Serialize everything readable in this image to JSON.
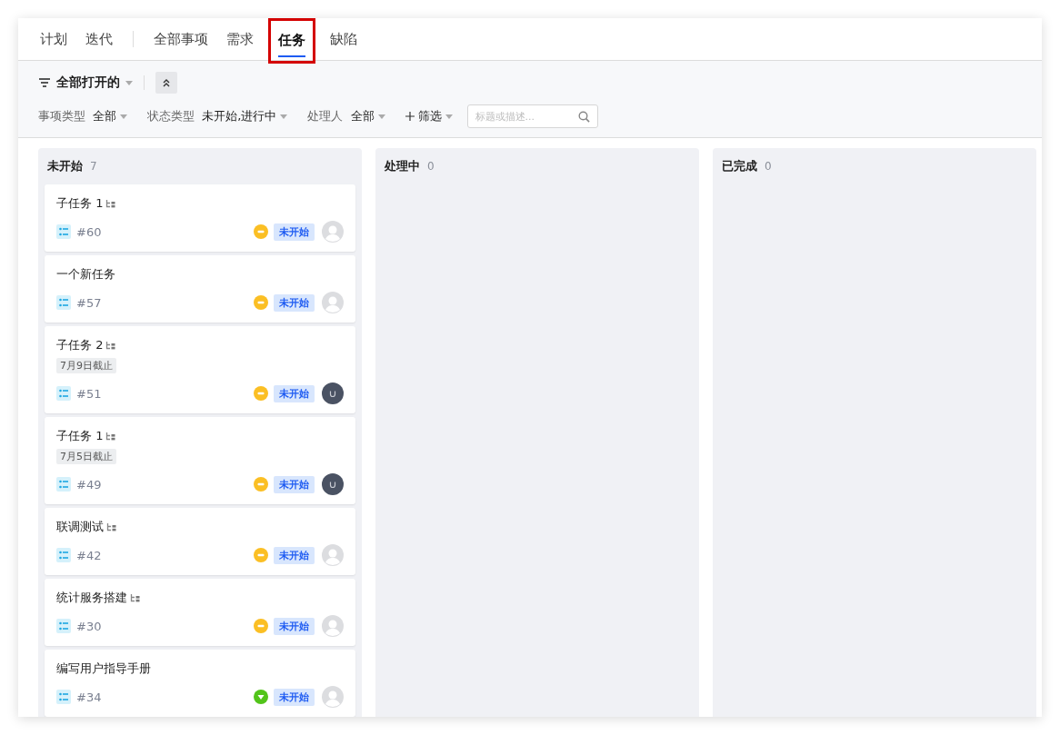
{
  "nav": {
    "views": [
      {
        "label": "计划",
        "selected": false
      },
      {
        "label": "迭代",
        "selected": false
      }
    ],
    "tabs": [
      {
        "label": "全部事项",
        "selected": false,
        "highlighted": false
      },
      {
        "label": "需求",
        "selected": false,
        "highlighted": false
      },
      {
        "label": "任务",
        "selected": true,
        "highlighted": true
      },
      {
        "label": "缺陷",
        "selected": false,
        "highlighted": false
      }
    ]
  },
  "toolbar": {
    "view_filter": "全部打开的",
    "filters": [
      {
        "label": "事项类型",
        "value": "全部"
      },
      {
        "label": "状态类型",
        "value": "未开始,进行中"
      },
      {
        "label": "处理人",
        "value": "全部"
      }
    ],
    "add_filter": "筛选",
    "search": {
      "placeholder": "标题或描述..."
    }
  },
  "columns": [
    {
      "title": "未开始",
      "count": "7",
      "cards": [
        {
          "title": "子任务 1",
          "has_subtasks": true,
          "id": "#60",
          "priority": {
            "kind": "medium",
            "color": "#fbbf24"
          },
          "status": "未开始",
          "assigned": false
        },
        {
          "title": "一个新任务",
          "has_subtasks": false,
          "id": "#57",
          "priority": {
            "kind": "medium",
            "color": "#fbbf24"
          },
          "status": "未开始",
          "assigned": false
        },
        {
          "title": "子任务 2",
          "has_subtasks": true,
          "due": "7月9日截止",
          "id": "#51",
          "priority": {
            "kind": "medium",
            "color": "#fbbf24"
          },
          "status": "未开始",
          "assigned": true
        },
        {
          "title": "子任务 1",
          "has_subtasks": true,
          "due": "7月5日截止",
          "id": "#49",
          "priority": {
            "kind": "medium",
            "color": "#fbbf24"
          },
          "status": "未开始",
          "assigned": true
        },
        {
          "title": "联调测试",
          "has_subtasks": true,
          "id": "#42",
          "priority": {
            "kind": "medium",
            "color": "#fbbf24"
          },
          "status": "未开始",
          "assigned": false
        },
        {
          "title": "统计服务搭建",
          "has_subtasks": true,
          "id": "#30",
          "priority": {
            "kind": "medium",
            "color": "#fbbf24"
          },
          "status": "未开始",
          "assigned": false
        },
        {
          "title": "编写用户指导手册",
          "has_subtasks": false,
          "id": "#34",
          "priority": {
            "kind": "low",
            "color": "#52c41a"
          },
          "status": "未开始",
          "assigned": false
        }
      ]
    },
    {
      "title": "处理中",
      "count": "0"
    },
    {
      "title": "已完成",
      "count": "0"
    }
  ]
}
